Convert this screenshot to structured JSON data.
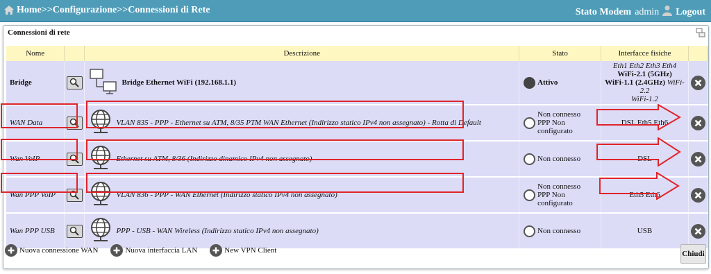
{
  "header": {
    "breadcrumb": "Home>>Configurazione>>Connessioni di Rete",
    "status_link": "Stato Modem",
    "user": "admin",
    "logout": "Logout"
  },
  "panel": {
    "title": "Connessioni di rete"
  },
  "table": {
    "columns": [
      "Nome",
      "",
      "Descrizione",
      "Stato",
      "Interfacce fisiche",
      ""
    ],
    "rows": [
      {
        "name": "Bridge",
        "description": "Bridge Ethernet WiFi (192.168.1.1)",
        "status_line1": "Attivo",
        "status_line2": "",
        "iface_line1": "Eth1 Eth2 Eth3 Eth4",
        "iface_line2": "WiFi-2.1 (5GHz)",
        "iface_line3a": "WiFi-1.1 (2.4GHz)",
        "iface_line3b": "WiFi-2.2",
        "iface_line4": "WiFi-1.2"
      },
      {
        "name": "WAN Data",
        "description": "VLAN 835 - PPP - Ethernet su ATM, 8/35 PTM WAN Ethernet (Indirizzo statico IPv4 non assegnato) - Rotta di Default",
        "status_line1": "Non connesso",
        "status_line2": "PPP Non configurato",
        "iface": "DSL Eth5 Eth6"
      },
      {
        "name": "Wan VoIP",
        "description": "Ethernet su ATM, 8/36 (Indirizzo dinamico IPv4 non assegnato)",
        "status_line1": "Non connesso",
        "status_line2": "",
        "iface": "DSL"
      },
      {
        "name": "Wan PPP VoIP",
        "description": "VLAN 836 - PPP - WAN Ethernet (Indirizzo statico IPv4 non assegnato)",
        "status_line1": "Non connesso",
        "status_line2": "PPP Non configurato",
        "iface": "Eth5 Eth6"
      },
      {
        "name": "Wan PPP USB",
        "description": "PPP - USB - WAN Wireless (Indirizzo statico IPv4 non assegnato)",
        "status_line1": "Non connesso",
        "status_line2": "",
        "iface": "USB"
      }
    ]
  },
  "actions": {
    "new_wan": "Nuova connessione WAN",
    "new_lan": "Nuova interfaccia LAN",
    "new_vpn": "New VPN Client",
    "close": "Chiudi"
  },
  "colors": {
    "topbar": "#4e9cb8",
    "header_row": "#fff7c2",
    "row_bg": "#dcdcf7",
    "annotation_red": "#e0242a"
  },
  "icons": [
    "home-icon",
    "user-icon",
    "panel-settings-icon",
    "magnifier-icon",
    "network-computers-icon",
    "globe-icon",
    "delete-icon",
    "plus-icon"
  ]
}
